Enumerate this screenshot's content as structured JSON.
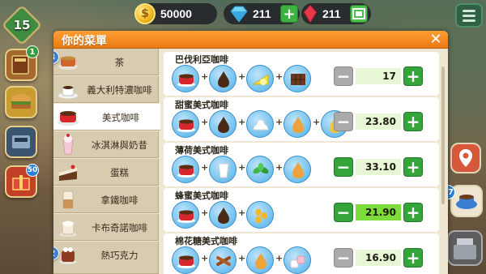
{
  "hud": {
    "level": "15",
    "coins": "50000",
    "gems": "211",
    "rubies": "211"
  },
  "rail_left": {
    "badge_top": "1",
    "badge_gift": "50"
  },
  "rail_right": {
    "badge_cup": "27"
  },
  "modal": {
    "title": "你的菜單",
    "categories": [
      {
        "label": "茶",
        "badge": "3"
      },
      {
        "label": "義大利特濃咖啡"
      },
      {
        "label": "美式咖啡"
      },
      {
        "label": "冰淇淋與奶昔"
      },
      {
        "label": "蛋糕"
      },
      {
        "label": "拿鐵咖啡"
      },
      {
        "label": "卡布奇諾咖啡"
      },
      {
        "label": "熱巧克力",
        "badge": "2"
      }
    ],
    "recipes": [
      {
        "name": "巴伐利亞咖啡",
        "price": "17",
        "ingredients": [
          "red-mug-icon",
          "coffee-drop-icon",
          "lemon-icon",
          "chocolate-icon"
        ]
      },
      {
        "name": "甜蜜美式咖啡",
        "price": "23.80",
        "ingredients": [
          "red-mug-icon",
          "coffee-drop-icon",
          "whipped-cream-icon",
          "syrup-drop-icon",
          "honey-drop-icon"
        ]
      },
      {
        "name": "薄荷美式咖啡",
        "price": "33.10",
        "ingredients": [
          "red-mug-icon",
          "milk-glass-icon",
          "mint-leaves-icon",
          "syrup-drop-icon"
        ]
      },
      {
        "name": "蜂蜜美式咖啡",
        "price": "21.90",
        "ingredients": [
          "red-mug-icon",
          "coffee-drop-icon",
          "honeycomb-icon"
        ]
      },
      {
        "name": "棉花糖美式咖啡",
        "price": "16.90",
        "ingredients": [
          "red-mug-icon",
          "cinnamon-icon",
          "syrup-drop-icon",
          "marshmallow-icon"
        ]
      }
    ]
  },
  "colors": {
    "header_orange": "#f38a1f",
    "plus_green": "#35a43a",
    "minus_gray": "#aaaaaa",
    "price_highlight": "#7bdc3a",
    "ingredient_blue": "#6fbfee",
    "badge_blue": "#3a7fd1"
  }
}
